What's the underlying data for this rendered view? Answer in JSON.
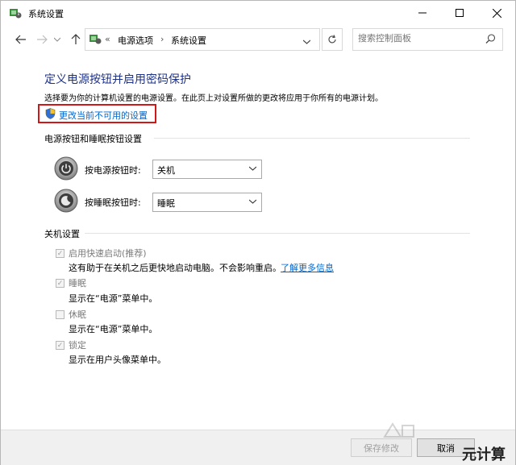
{
  "window": {
    "title": "系统设置"
  },
  "nav": {
    "breadcrumb_prefix": "«",
    "crumb1": "电源选项",
    "crumb_sep": "›",
    "crumb2": "系统设置",
    "search_placeholder": "搜索控制面板"
  },
  "main": {
    "heading": "定义电源按钮并启用密码保护",
    "description": "选择要为你的计算机设置的电源设置。在此页上对设置所做的更改将应用于你所有的电源计划。",
    "change_link": "更改当前不可用的设置"
  },
  "buttons_section": {
    "title": "电源按钮和睡眠按钮设置",
    "power_label": "按电源按钮时:",
    "power_value": "关机",
    "sleep_label": "按睡眠按钮时:",
    "sleep_value": "睡眠"
  },
  "shutdown_section": {
    "title": "关机设置",
    "items": [
      {
        "label": "启用快速启动(推荐)",
        "checked": true,
        "desc": "这有助于在关机之后更快地启动电脑。不会影响重启。",
        "link": "了解更多信息"
      },
      {
        "label": "睡眠",
        "checked": true,
        "desc": "显示在“电源”菜单中。"
      },
      {
        "label": "休眠",
        "checked": false,
        "desc": "显示在“电源”菜单中。"
      },
      {
        "label": "锁定",
        "checked": true,
        "desc": "显示在用户头像菜单中。"
      }
    ]
  },
  "footer": {
    "save": "保存修改",
    "cancel": "取消"
  },
  "watermark": {
    "text": "元计算"
  }
}
